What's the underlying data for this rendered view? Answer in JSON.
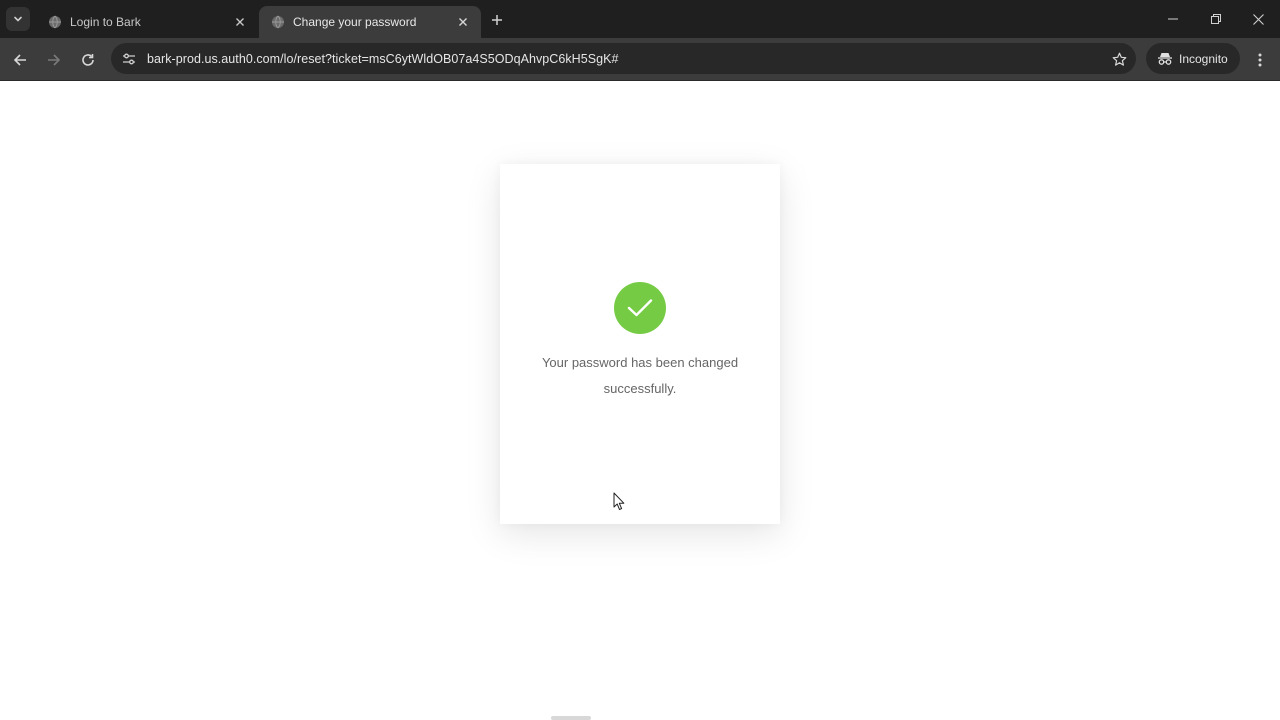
{
  "browser": {
    "tabs": [
      {
        "title": "Login to Bark",
        "active": false
      },
      {
        "title": "Change your password",
        "active": true
      }
    ],
    "url": "bark-prod.us.auth0.com/lo/reset?ticket=msC6ytWldOB07a4S5ODqAhvpC6kH5SgK#",
    "incognito_label": "Incognito"
  },
  "page": {
    "message": "Your password has been changed successfully.",
    "success_color": "#75cc44",
    "icon": "checkmark-icon"
  }
}
